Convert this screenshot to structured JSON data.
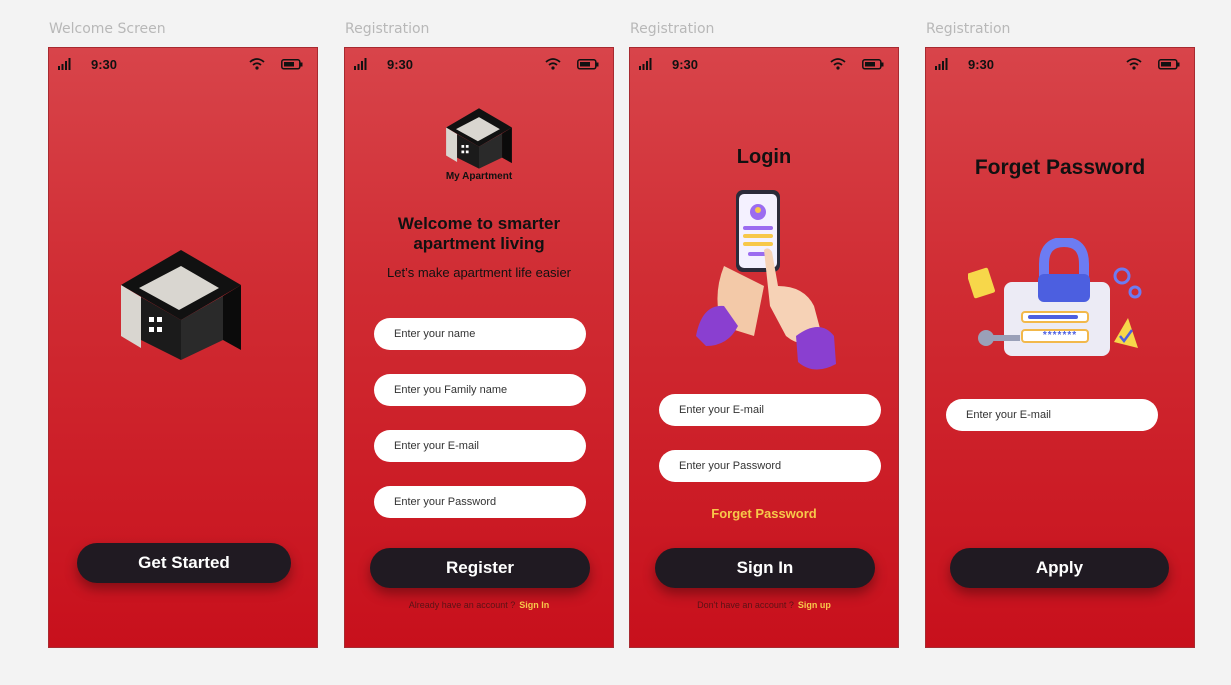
{
  "labels": [
    "Welcome Screen",
    "Registration",
    "Registration",
    "Registration"
  ],
  "status": {
    "time": "9:30"
  },
  "welcome": {
    "button": "Get Started"
  },
  "register": {
    "logo_text": "My Apartment",
    "headline": "Welcome to smarter apartment living",
    "subline": "Let’s make apartment life easier",
    "fields": [
      "Enter your name",
      "Enter you Family name",
      "Enter your E-mail",
      "Enter your Password"
    ],
    "button": "Register",
    "footer_text": "Already have an account ?",
    "footer_link": "Sign In"
  },
  "login": {
    "title": "Login",
    "fields": [
      "Enter your E-mail",
      "Enter your Password"
    ],
    "forgot": "Forget Password",
    "button": "Sign In",
    "footer_text": "Don't have an account ?",
    "footer_link": "Sign up"
  },
  "forgot": {
    "title": "Forget Password",
    "field": "Enter your E-mail",
    "password_mask": "*******",
    "button": "Apply"
  },
  "colors": {
    "accent": "#d0282f",
    "button": "#201a22",
    "link": "#f7c84a"
  }
}
